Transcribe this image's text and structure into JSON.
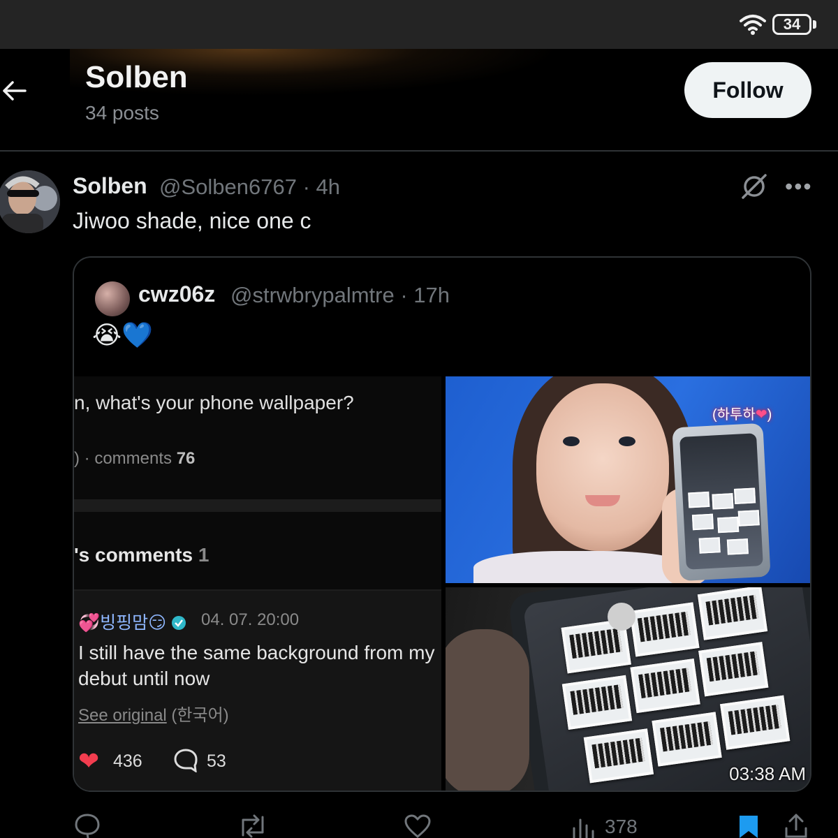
{
  "status_bar": {
    "battery": "34"
  },
  "header": {
    "name": "Solben",
    "posts": "34 posts",
    "follow_label": "Follow"
  },
  "tweet": {
    "author": "Solben",
    "meta": "@Solben6767 · 4h",
    "text": "Jiwoo shade, nice one c"
  },
  "quote": {
    "author": "cwz06z",
    "meta": "@strwbrypalmtre · 17h",
    "emoji": "😭💙",
    "screenshot": {
      "question": "n, what's your phone wallpaper?",
      "stats_prefix": ") · comments",
      "stats_count": "76",
      "comments_heading": "'s comments",
      "comments_count": "1",
      "comment_user": "💞빙핑맘😏",
      "comment_date": "04. 07. 20:00",
      "comment_body": "I still have the same background from my debut until now",
      "see_original": "See original",
      "original_lang": "(한국어)",
      "likes": "436",
      "replies": "53"
    },
    "photo_tag": "(하투하❤)",
    "photo_tag_text": "(하투하",
    "photo_timestamp": "03:38 AM"
  },
  "actions": {
    "views": "378"
  }
}
